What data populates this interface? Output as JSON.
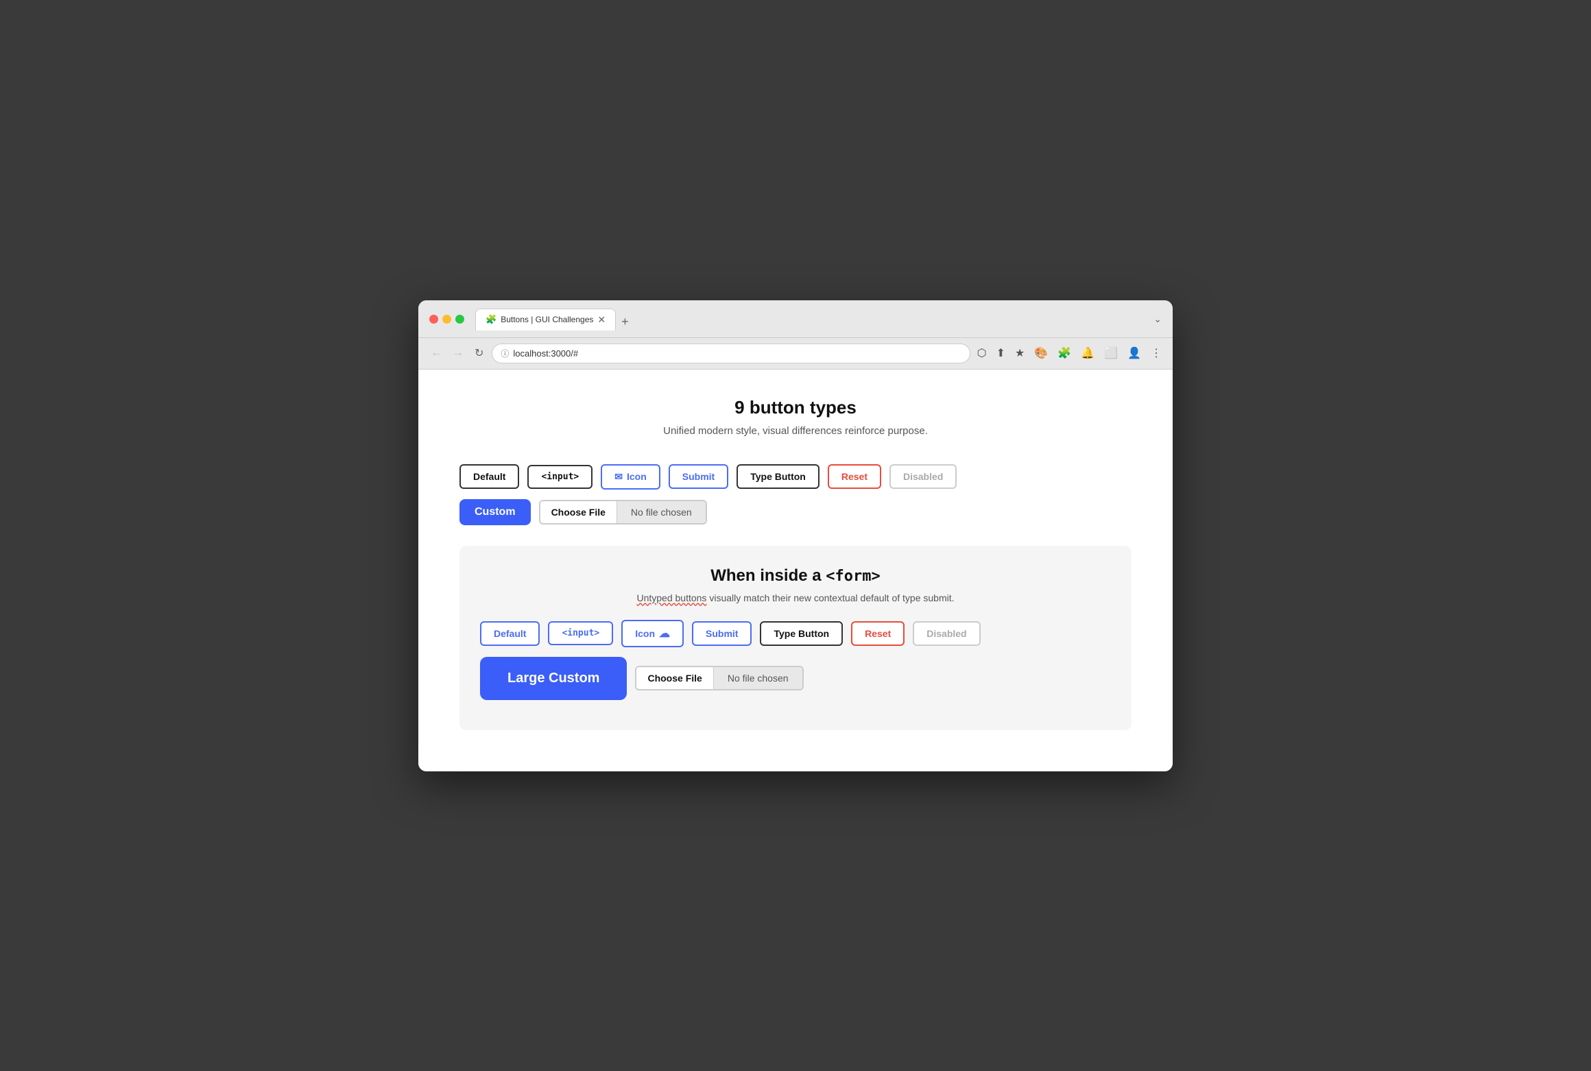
{
  "browser": {
    "tab_title": "Buttons | GUI Challenges",
    "tab_icon": "🧩",
    "address": "localhost:3000/#",
    "new_tab_label": "+",
    "chevron_label": "⌄"
  },
  "toolbar": {
    "back_label": "←",
    "forward_label": "→",
    "reload_label": "↻",
    "actions": [
      "⬡",
      "⬆",
      "★",
      "🎨",
      "🧩",
      "🔔",
      "⬜",
      "👤",
      "⋮"
    ]
  },
  "page": {
    "title": "9 button types",
    "subtitle": "Unified modern style, visual differences reinforce purpose.",
    "row1": {
      "default_label": "Default",
      "input_label": "<input>",
      "icon_label": "Icon",
      "submit_label": "Submit",
      "type_label": "Type Button",
      "reset_label": "Reset",
      "disabled_label": "Disabled"
    },
    "row2": {
      "custom_label": "Custom",
      "choose_file_label": "Choose File",
      "no_file_label": "No file chosen"
    },
    "form_section": {
      "title_text": "When inside a ",
      "title_code": "<form>",
      "subtitle_untyped": "Untyped buttons",
      "subtitle_rest": " visually match their new contextual default of type submit.",
      "row1": {
        "default_label": "Default",
        "input_label": "<input>",
        "icon_label": "Icon",
        "submit_label": "Submit",
        "type_label": "Type Button",
        "reset_label": "Reset",
        "disabled_label": "Disabled"
      },
      "row2": {
        "custom_label": "Large Custom",
        "choose_file_label": "Choose File",
        "no_file_label": "No file chosen"
      }
    }
  }
}
